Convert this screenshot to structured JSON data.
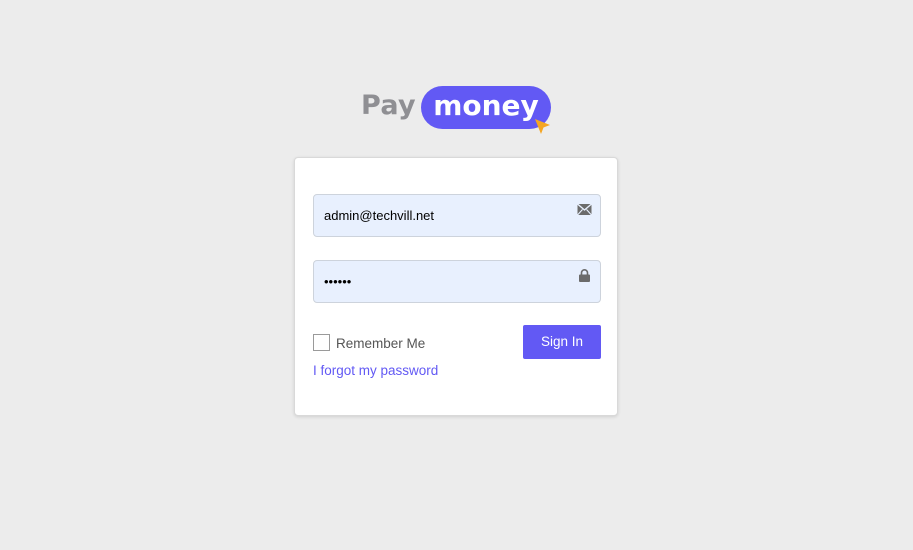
{
  "logo": {
    "pay_text": "Pay",
    "money_text": "money"
  },
  "login": {
    "email": {
      "value": "admin@techvill.net",
      "icon": "envelope-icon"
    },
    "password": {
      "value": "••••••",
      "icon": "lock-icon"
    },
    "remember_label": "Remember Me",
    "sign_in_label": "Sign In",
    "forgot_label": "I forgot my password"
  },
  "colors": {
    "background": "#ececec",
    "brand": "#6259f4",
    "logo_gray": "#8f8f93",
    "cursor_orange": "#f5a623",
    "field_fill": "#e8f0fe"
  }
}
